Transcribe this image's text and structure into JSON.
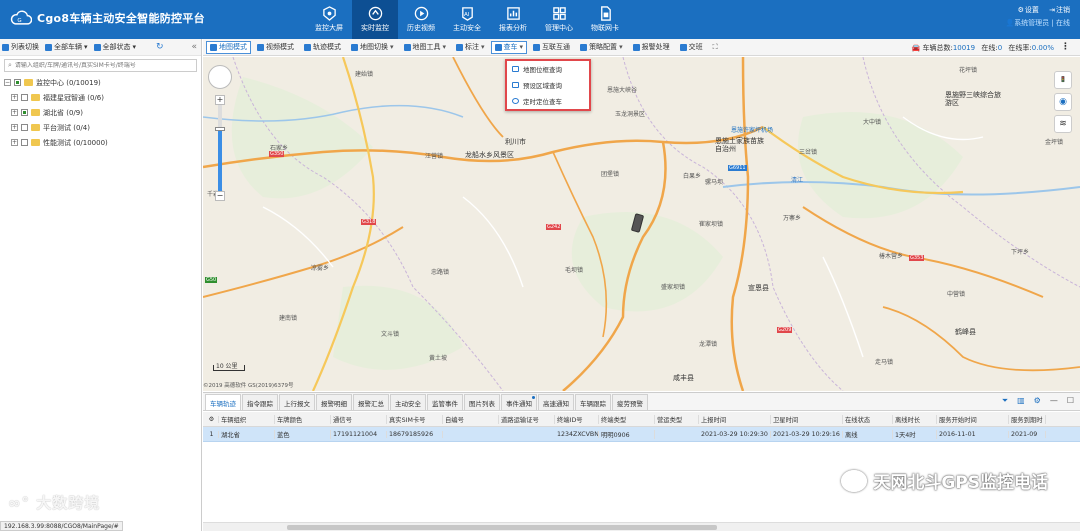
{
  "header": {
    "app_title": "Cgo8车辆主动安全智能防控平台",
    "nav": [
      {
        "label": "监控大屏",
        "icon": "monitor-icon"
      },
      {
        "label": "实时监控",
        "icon": "realtime-icon",
        "active": true
      },
      {
        "label": "历史视频",
        "icon": "history-video-icon"
      },
      {
        "label": "主动安全",
        "icon": "ai-icon"
      },
      {
        "label": "报表分析",
        "icon": "report-icon"
      },
      {
        "label": "管理中心",
        "icon": "manage-icon"
      },
      {
        "label": "物联网卡",
        "icon": "sim-card-icon"
      }
    ],
    "settings_label": "设置",
    "logout_label": "注销",
    "user_label": "系统管理员 | 在线"
  },
  "sidebar": {
    "toolbar": {
      "list_switch": "列表切换",
      "all_vehicles": "全部车辆",
      "all_status": "全部状态"
    },
    "search_placeholder": "请输入组织/车牌/通讯号/真实SIM卡号/终端号",
    "tree": {
      "root": "监控中心 (0/10019)",
      "children": [
        {
          "label": "福建星冠智通 (0/6)"
        },
        {
          "label": "湖北省 (0/9)"
        },
        {
          "label": "平台测试 (0/4)"
        },
        {
          "label": "性能测试 (0/10000)"
        }
      ]
    }
  },
  "map_toolbar": {
    "items": [
      "地图模式",
      "视频模式",
      "轨迹模式",
      "地图切换",
      "地图工具",
      "标注",
      "查车",
      "互联互通",
      "策略配置",
      "报警处理",
      "交班"
    ],
    "vehicle_total_label": "车辆总数:",
    "vehicle_total": "10019",
    "online_label": "在线:",
    "online": "0",
    "online_rate_label": "在线率:",
    "online_rate": "0.00%"
  },
  "dropdown": {
    "items": [
      "地图位框查询",
      "预设区域查询",
      "定时定位查车"
    ]
  },
  "map": {
    "labels": [
      "建始镇",
      "石家乡",
      "龙船水乡风景区",
      "利川市",
      "恩施大峡谷",
      "玉龙洞景区",
      "恩施许家坪机场",
      "恩施土家族苗族自治州",
      "三岔镇",
      "白果乡",
      "团堡镇",
      "汪营镇",
      "毛坝镇",
      "千岩乡",
      "盛家坝镇",
      "清江",
      "崔家坝镇",
      "花坪镇",
      "恩施野三峡综合旅游区",
      "建南镇",
      "凉雾乡",
      "文斗镇",
      "宣恩县",
      "咸丰县",
      "中营镇",
      "鹤峰县",
      "大中镇",
      "忠路镇",
      "黄土坡",
      "金坪镇",
      "骡马坝",
      "龙潭镇",
      "万寨乡",
      "椿木营乡",
      "走马镇",
      "下坪乡"
    ],
    "routes": [
      "G350",
      "G318",
      "G242",
      "G6911",
      "G353",
      "G209",
      "G50"
    ],
    "scale_label": "10 公里",
    "copyright": "©2019 高德软件 GS(2019)6379号"
  },
  "bottom": {
    "tabs": [
      "车辆轨迹",
      "指令跟踪",
      "上行报文",
      "报警明细",
      "报警汇总",
      "主动安全",
      "监管事件",
      "图片列表",
      "事件通知",
      "高速通知",
      "车辆跟踪",
      "疲劳预警"
    ],
    "columns": [
      "车辆组织",
      "车牌颜色",
      "通信号",
      "真实SIM卡号",
      "自编号",
      "道路运输证号",
      "终端ID号",
      "终端类型",
      "营运类型",
      "上报时间",
      "卫星时间",
      "在线状态",
      "离线时长",
      "服务开始时间",
      "服务到期时"
    ],
    "rows": [
      [
        "湖北省",
        "蓝色",
        "17191121004",
        "18679185926",
        "",
        "",
        "1234ZXCVBN",
        "明明0906",
        "",
        "2021-03-29 10:29:30",
        "2021-03-29 10:29:16",
        "离线",
        "1天4时",
        "2016-11-01",
        "2021-09"
      ]
    ]
  },
  "overlay": {
    "url": "192.168.3.99:8088/CGO8/MainPage/#",
    "watermark_left": "大数跨境",
    "watermark_right": "天网北斗GPS监控电话"
  }
}
